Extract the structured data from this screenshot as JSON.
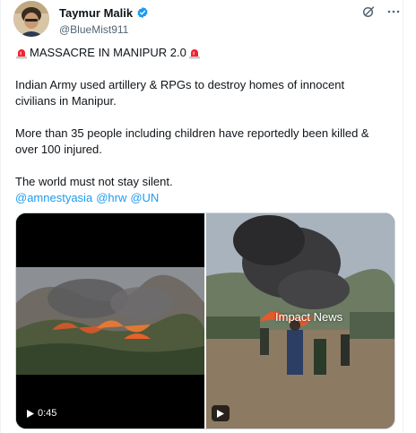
{
  "author": {
    "display_name": "Taymur Malik",
    "handle": "@BlueMist911",
    "verified_icon": "verified-badge-icon",
    "avatar_icon": "avatar"
  },
  "actions": {
    "grok_icon": "grok-icon",
    "more_icon": "more-options-icon"
  },
  "tweet": {
    "headline": "MASSACRE IN MANIPUR 2.0",
    "headline_emoji": "police-siren-icon",
    "paragraph1": "Indian Army used artillery & RPGs to destroy homes of innocent civilians in Manipur.",
    "paragraph2": "More than 35 people including children have reportedly been killed & over 100 injured.",
    "paragraph3": "The world must not stay silent.",
    "mentions": [
      "@amnestyasia",
      "@hrw",
      "@UN"
    ]
  },
  "media": {
    "left_video_duration": "0:45",
    "right_video_watermark": "Impact News"
  },
  "colors": {
    "link": "#1d9bf0",
    "text": "#0f1419",
    "secondary": "#536471",
    "siren": "#f4212e"
  }
}
